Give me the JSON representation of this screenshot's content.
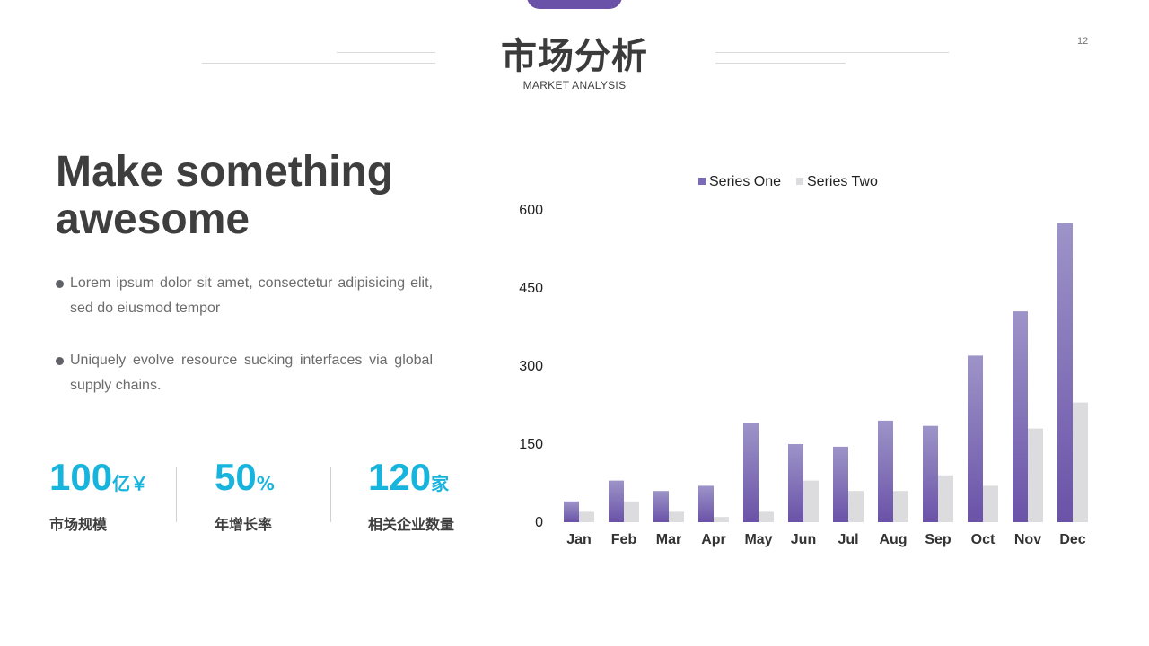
{
  "page": {
    "title": "市场分析",
    "subtitle": "MARKET ANALYSIS",
    "page_number": "12",
    "accent_color": "#6a52a8"
  },
  "content": {
    "headline": "Make something awesome",
    "bullets": [
      "Lorem ipsum dolor sit amet, consectetur adipisicing elit, sed do eiusmod tempor",
      "Uniquely evolve resource sucking interfaces via global supply chains."
    ]
  },
  "stats": [
    {
      "value": "100",
      "unit": "亿￥",
      "label": "市场规模"
    },
    {
      "value": "50",
      "unit": "%",
      "label": "年增长率"
    },
    {
      "value": "120",
      "unit": "家",
      "label": "相关企业数量"
    }
  ],
  "stat_color": "#17b4dd",
  "chart_data": {
    "type": "bar",
    "title": "",
    "xlabel": "",
    "ylabel": "",
    "categories": [
      "Jan",
      "Feb",
      "Mar",
      "Apr",
      "May",
      "Jun",
      "Jul",
      "Aug",
      "Sep",
      "Oct",
      "Nov",
      "Dec"
    ],
    "series": [
      {
        "name": "Series One",
        "color": "#6a52a8",
        "values": [
          40,
          80,
          60,
          70,
          190,
          150,
          145,
          195,
          185,
          320,
          405,
          575
        ]
      },
      {
        "name": "Series Two",
        "color": "#dcdcde",
        "values": [
          20,
          40,
          20,
          10,
          20,
          80,
          60,
          60,
          90,
          70,
          180,
          230
        ]
      }
    ],
    "ylim": [
      0,
      600
    ],
    "yticks": [
      0,
      150,
      300,
      450,
      600
    ],
    "grid": false,
    "legend": "top-center"
  }
}
